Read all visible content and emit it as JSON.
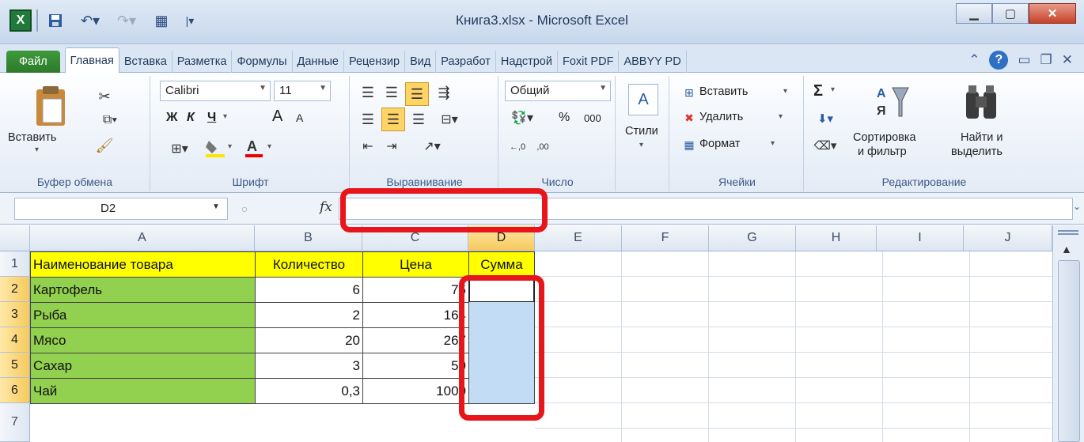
{
  "window": {
    "title": "Книга3.xlsx - Microsoft Excel",
    "app_icon": "excel-icon",
    "controls": [
      "minimize",
      "maximize",
      "close"
    ]
  },
  "quick_access": [
    "save-icon",
    "undo-icon",
    "redo-icon",
    "form-icon",
    "customize-icon"
  ],
  "tabs": [
    "Файл",
    "Главная",
    "Вставка",
    "Разметка",
    "Формулы",
    "Данные",
    "Рецензир",
    "Вид",
    "Разработ",
    "Надстрой",
    "Foxit PDF",
    "ABBYY PD"
  ],
  "active_tab": "Главная",
  "ribbon": {
    "clipboard": {
      "label": "Буфер обмена",
      "paste": "Вставить"
    },
    "font": {
      "label": "Шрифт",
      "name": "Calibri",
      "size": "11",
      "bold": "Ж",
      "italic": "К",
      "underline": "Ч",
      "grow": "A",
      "shrink": "A"
    },
    "alignment": {
      "label": "Выравнивание"
    },
    "number": {
      "label": "Число",
      "format": "Общий",
      "percent": "%",
      "thousands": "000"
    },
    "styles": {
      "label": "Стили"
    },
    "cells": {
      "label": "Ячейки",
      "insert": "Вставить",
      "delete": "Удалить",
      "format": "Формат"
    },
    "editing": {
      "label": "Редактирование",
      "sort": "Сортировка",
      "sort2": "и фильтр",
      "find": "Найти и",
      "find2": "выделить",
      "sigma": "Σ"
    }
  },
  "formula_bar": {
    "name_box": "D2",
    "fx": "fx",
    "content": ""
  },
  "columns": [
    "A",
    "B",
    "C",
    "D",
    "E",
    "F",
    "G",
    "H",
    "I",
    "J"
  ],
  "selected_column": "D",
  "rows": [
    "1",
    "2",
    "3",
    "4",
    "5",
    "6",
    "7"
  ],
  "table": {
    "headers": [
      "Наименование товара",
      "Количество",
      "Цена",
      "Сумма"
    ],
    "data": [
      [
        "Картофель",
        "6",
        "75",
        ""
      ],
      [
        "Рыба",
        "2",
        "164",
        ""
      ],
      [
        "Мясо",
        "20",
        "267",
        ""
      ],
      [
        "Сахар",
        "3",
        "50",
        ""
      ],
      [
        "Чай",
        "0,3",
        "1000",
        ""
      ]
    ]
  },
  "colors": {
    "header_fill": "#ffff00",
    "name_fill": "#92d050",
    "selection_fill": "#c2dcf6",
    "highlight": "#e8161a"
  }
}
